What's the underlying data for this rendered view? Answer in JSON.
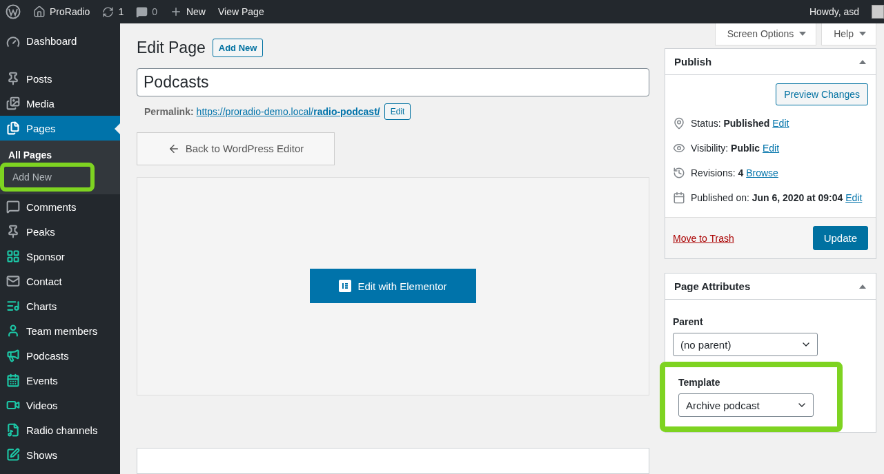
{
  "admin_bar": {
    "site": "ProRadio",
    "updates": "1",
    "comments": "0",
    "new": "New",
    "view": "View Page",
    "greeting": "Howdy, asd"
  },
  "sidebar": {
    "items": [
      {
        "label": "Dashboard",
        "color": "#a0a5aa",
        "selected": false
      },
      {
        "label": "Posts",
        "color": "#a0a5aa",
        "selected": false
      },
      {
        "label": "Media",
        "color": "#a0a5aa",
        "selected": false
      },
      {
        "label": "Pages",
        "color": "#ffffff",
        "selected": true,
        "children": [
          {
            "label": "All Pages",
            "selected": true,
            "highlighted": false
          },
          {
            "label": "Add New",
            "selected": false,
            "highlighted": true
          }
        ]
      },
      {
        "label": "Comments",
        "color": "#a0a5aa",
        "selected": false
      },
      {
        "label": "Peaks",
        "color": "#a0a5aa",
        "selected": false
      },
      {
        "label": "Sponsor",
        "color": "#1cc9a8",
        "selected": false
      },
      {
        "label": "Contact",
        "color": "#a0a5aa",
        "selected": false
      },
      {
        "label": "Charts",
        "color": "#1cc9a8",
        "selected": false
      },
      {
        "label": "Team members",
        "color": "#1cc9a8",
        "selected": false
      },
      {
        "label": "Podcasts",
        "color": "#1cc9a8",
        "selected": false
      },
      {
        "label": "Events",
        "color": "#1cc9a8",
        "selected": false
      },
      {
        "label": "Videos",
        "color": "#1cc9a8",
        "selected": false
      },
      {
        "label": "Radio channels",
        "color": "#1cc9a8",
        "selected": false
      },
      {
        "label": "Shows",
        "color": "#1cc9a8",
        "selected": false
      }
    ]
  },
  "screen_tabs": [
    "Screen Options",
    "Help"
  ],
  "heading": "Edit Page",
  "add_new": "Add New",
  "title_value": "Podcasts",
  "permalink": {
    "label": "Permalink:",
    "url": "https://proradio-demo.local/**radio-podcast/**",
    "edit": "Edit"
  },
  "back_button": "Back to WordPress Editor",
  "elementor_button": "Edit with Elementor",
  "publish": {
    "title": "Publish",
    "expanded": true,
    "preview": "Preview Changes",
    "rows": [
      {
        "label": "Status:",
        "value": "Published",
        "link": "Edit"
      },
      {
        "label": "Visibility:",
        "value": "Public",
        "link": "Edit"
      },
      {
        "label": "Revisions:",
        "value": "4",
        "link": "Browse"
      },
      {
        "label": "Published on:",
        "value": "Jun 6, 2020 at 09:04",
        "link": "Edit"
      }
    ],
    "trash": "Move to Trash",
    "update": "Update"
  },
  "page_attributes": {
    "title": "Page Attributes",
    "expanded": true,
    "parent_label": "Parent",
    "parent_value": "(no parent)",
    "template_label": "Template",
    "template_value": "Archive podcast",
    "template_highlighted": true
  }
}
